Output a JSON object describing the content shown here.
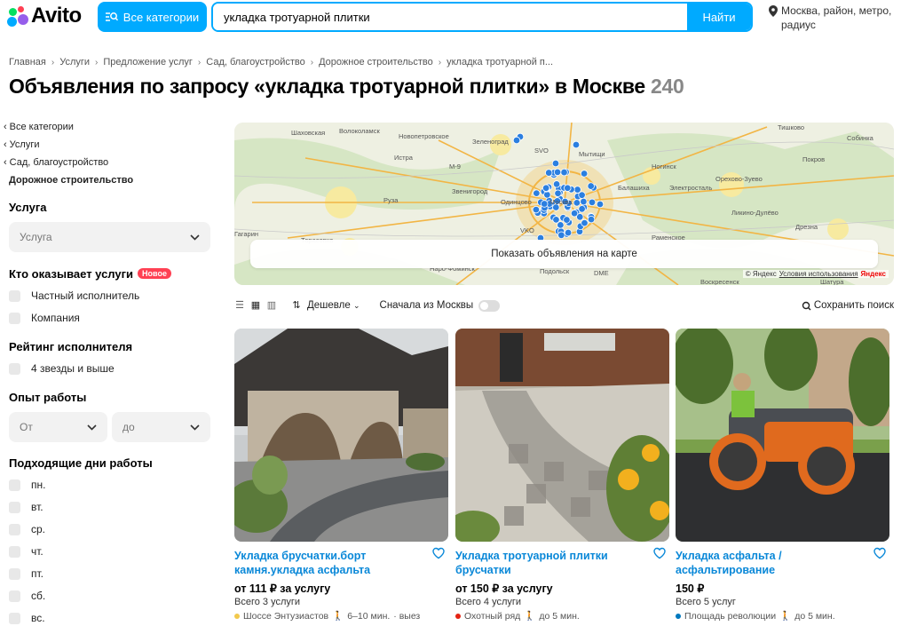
{
  "header": {
    "logo_text": "Avito",
    "categories_label": "Все категории",
    "search_value": "укладка тротуарной плитки",
    "search_button": "Найти",
    "location_text": "Москва, район, метро, радиус"
  },
  "breadcrumbs": [
    "Главная",
    "Услуги",
    "Предложение услуг",
    "Сад, благоустройство",
    "Дорожное строительство",
    "укладка тротуарной п..."
  ],
  "page": {
    "title": "Объявления по запросу «укладка тротуарной плитки» в Москве",
    "count": "240"
  },
  "sidebar": {
    "nav": [
      "Все категории",
      "Услуги",
      "Сад, благоустройство"
    ],
    "current": "Дорожное строительство",
    "service_title": "Услуга",
    "service_placeholder": "Услуга",
    "provider_title": "Кто оказывает услуги",
    "provider_badge": "Новое",
    "provider_options": [
      "Частный исполнитель",
      "Компания"
    ],
    "rating_title": "Рейтинг исполнителя",
    "rating_option": "4 звезды и выше",
    "experience_title": "Опыт работы",
    "exp_from": "От",
    "exp_to": "до",
    "days_title": "Подходящие дни работы",
    "days": [
      "пн.",
      "вт.",
      "ср.",
      "чт.",
      "пт.",
      "сб.",
      "вс."
    ]
  },
  "map": {
    "button": "Показать объявления на карте",
    "copyright": "© Яндекс",
    "terms": "Условия использования",
    "brand": "Яндекс",
    "labels": [
      "Шаховская",
      "Волоколамск",
      "Новопетровское",
      "Зеленоград",
      "Тишково",
      "Собинка",
      "Истра",
      "Мытищи",
      "SVO",
      "Ногинск",
      "Покров",
      "M-9",
      "Звенигород",
      "Балашиха",
      "Электросталь",
      "Орехово-Зуево",
      "Руза",
      "Одинцово",
      "Москва",
      "Ликино-Дулёво",
      "Гагарин",
      "Тарасовка",
      "VKO",
      "Раменское",
      "Дрезна",
      "Наро-Фоминск",
      "DME",
      "Подольск",
      "Воскресенск",
      "Шатура"
    ]
  },
  "toolbar": {
    "sort_label": "Дешевле",
    "moscow_first": "Сначала из Москвы",
    "save_search": "Сохранить поиск"
  },
  "listings": [
    {
      "title": "Укладка брусчатки.борт камня.укладка асфальта",
      "price": "от 111 ₽ за услугу",
      "services": "Всего 3 услуги",
      "station": "Шоссе Энтузиастов",
      "walk": "6–10 мин.",
      "extra": "· выез",
      "station_color": "#f2c94c"
    },
    {
      "title": "Укладка тротуарной плитки брусчатки",
      "price": "от 150 ₽ за услугу",
      "services": "Всего 4 услуги",
      "station": "Охотный ряд",
      "walk": "до 5 мин.",
      "extra": "",
      "station_color": "#e42313"
    },
    {
      "title": "Укладка асфальта / асфальтирование",
      "price": "150 ₽",
      "services": "Всего 5 услуг",
      "station": "Площадь революции",
      "walk": "до 5 мин.",
      "extra": "",
      "station_color": "#0078be"
    }
  ],
  "colors": {
    "accent": "#00aaff",
    "link": "#0a88d8",
    "badge": "#ff4053"
  }
}
